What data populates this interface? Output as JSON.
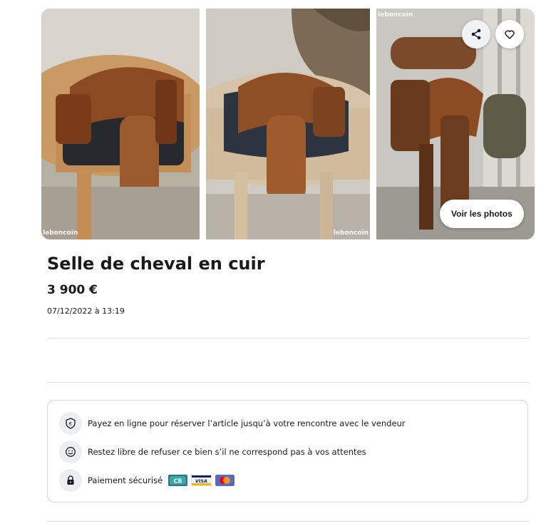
{
  "gallery": {
    "watermark": "leboncoin",
    "share_icon": "share-icon",
    "favorite_icon": "heart-icon",
    "view_photos_label": "Voir les photos"
  },
  "listing": {
    "title": "Selle de cheval en cuir",
    "price": "3 900 €",
    "date": "07/12/2022 à 13:19"
  },
  "payment": {
    "items": [
      {
        "icon": "euro-shield-icon",
        "text": "Payez en ligne pour réserver l’article jusqu’à votre rencontre avec le vendeur"
      },
      {
        "icon": "smile-icon",
        "text": "Restez libre de refuser ce bien s’il ne correspond pas à vos attentes"
      },
      {
        "icon": "lock-icon",
        "text": "Paiement sécurisé"
      }
    ],
    "cards": [
      {
        "name": "CB",
        "color": "#2c6e8f"
      },
      {
        "name": "VISA",
        "color": "#1a1f71"
      },
      {
        "name": "Mastercard",
        "color": "#eb001b"
      }
    ]
  }
}
